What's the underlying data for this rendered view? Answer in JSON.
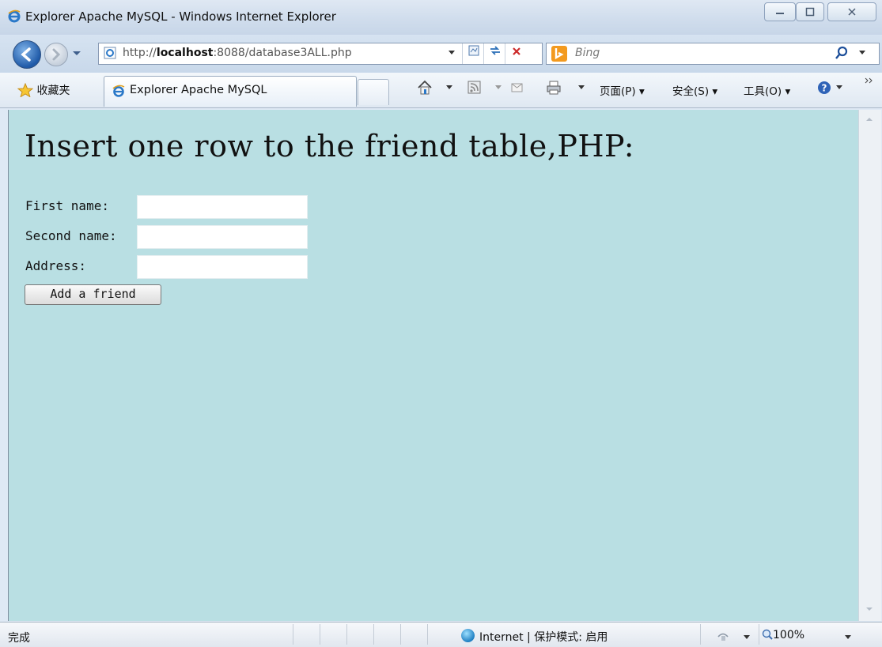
{
  "window": {
    "title": "Explorer Apache MySQL - Windows Internet Explorer"
  },
  "address_bar": {
    "url_prefix": "http://",
    "url_host": "localhost",
    "url_rest": ":8088/database3ALL.php"
  },
  "search": {
    "placeholder": "Bing"
  },
  "command_bar": {
    "favorites_label": "收藏夹",
    "tab_title": "Explorer Apache MySQL",
    "page_menu": "页面(P) ▾",
    "safety_menu": "安全(S) ▾",
    "tools_menu": "工具(O) ▾"
  },
  "page": {
    "heading": "Insert one row to the friend table,PHP:",
    "form": {
      "first_name_label": "First name:",
      "second_name_label": "Second name:",
      "address_label": "Address:",
      "first_name_value": "",
      "second_name_value": "",
      "address_value": "",
      "submit_label": "Add a friend"
    },
    "background_color": "#b9dfe3"
  },
  "status_bar": {
    "status": "完成",
    "zone": "Internet | 保护模式: 启用",
    "zoom": "100%"
  }
}
